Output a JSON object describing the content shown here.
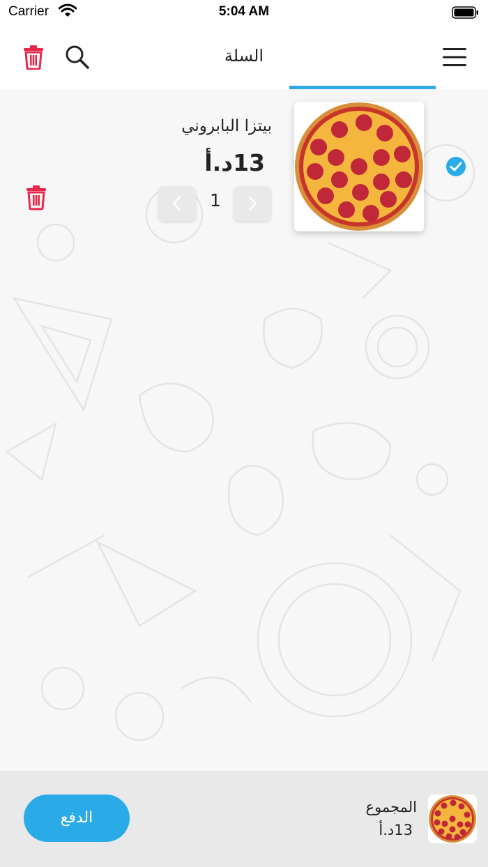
{
  "status_bar": {
    "carrier": "Carrier",
    "time": "5:04 AM",
    "icons": [
      "wifi-icon",
      "battery-icon"
    ]
  },
  "header": {
    "title": "السلة",
    "left_icons": [
      "trash-icon",
      "search-icon"
    ],
    "right_icons": [
      "menu-icon"
    ],
    "accent_color": "#2fa8e6",
    "trash_color": "#e8274b"
  },
  "cart": {
    "items": [
      {
        "name": "بيتزا البابروني",
        "price": "13د.أ",
        "quantity": "1",
        "selected": true,
        "image_icon": "pepperoni-pizza-icon"
      }
    ]
  },
  "footer": {
    "pay_label": "الدفع",
    "total_label": "المجموع",
    "total_value": "13د.أ",
    "pay_color": "#2aabe8"
  }
}
